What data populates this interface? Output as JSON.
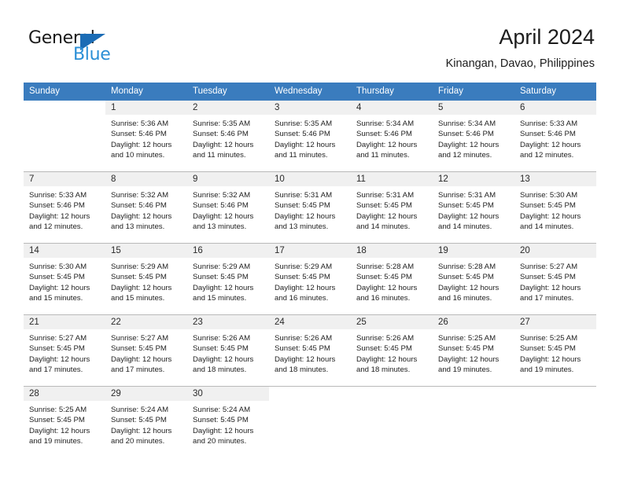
{
  "brand": {
    "name_top": "General",
    "name_bottom": "Blue",
    "color_dark": "#1a1a1a",
    "color_blue": "#2b8fd6",
    "triangle_color": "#1b6cb5"
  },
  "header": {
    "title": "April 2024",
    "subtitle": "Kinangan, Davao, Philippines"
  },
  "theme": {
    "header_row_bg": "#3a7cbe",
    "header_row_text": "#ffffff",
    "daynum_bg": "#f0f0f0",
    "grid_line": "#b9b9b9",
    "body_text": "#222222"
  },
  "weekdays": [
    "Sunday",
    "Monday",
    "Tuesday",
    "Wednesday",
    "Thursday",
    "Friday",
    "Saturday"
  ],
  "weeks": [
    [
      {
        "blank": true,
        "day": ""
      },
      {
        "blank": false,
        "day": "1",
        "sunrise": "Sunrise: 5:36 AM",
        "sunset": "Sunset: 5:46 PM",
        "daylight1": "Daylight: 12 hours",
        "daylight2": "and 10 minutes."
      },
      {
        "blank": false,
        "day": "2",
        "sunrise": "Sunrise: 5:35 AM",
        "sunset": "Sunset: 5:46 PM",
        "daylight1": "Daylight: 12 hours",
        "daylight2": "and 11 minutes."
      },
      {
        "blank": false,
        "day": "3",
        "sunrise": "Sunrise: 5:35 AM",
        "sunset": "Sunset: 5:46 PM",
        "daylight1": "Daylight: 12 hours",
        "daylight2": "and 11 minutes."
      },
      {
        "blank": false,
        "day": "4",
        "sunrise": "Sunrise: 5:34 AM",
        "sunset": "Sunset: 5:46 PM",
        "daylight1": "Daylight: 12 hours",
        "daylight2": "and 11 minutes."
      },
      {
        "blank": false,
        "day": "5",
        "sunrise": "Sunrise: 5:34 AM",
        "sunset": "Sunset: 5:46 PM",
        "daylight1": "Daylight: 12 hours",
        "daylight2": "and 12 minutes."
      },
      {
        "blank": false,
        "day": "6",
        "sunrise": "Sunrise: 5:33 AM",
        "sunset": "Sunset: 5:46 PM",
        "daylight1": "Daylight: 12 hours",
        "daylight2": "and 12 minutes."
      }
    ],
    [
      {
        "blank": false,
        "day": "7",
        "sunrise": "Sunrise: 5:33 AM",
        "sunset": "Sunset: 5:46 PM",
        "daylight1": "Daylight: 12 hours",
        "daylight2": "and 12 minutes."
      },
      {
        "blank": false,
        "day": "8",
        "sunrise": "Sunrise: 5:32 AM",
        "sunset": "Sunset: 5:46 PM",
        "daylight1": "Daylight: 12 hours",
        "daylight2": "and 13 minutes."
      },
      {
        "blank": false,
        "day": "9",
        "sunrise": "Sunrise: 5:32 AM",
        "sunset": "Sunset: 5:46 PM",
        "daylight1": "Daylight: 12 hours",
        "daylight2": "and 13 minutes."
      },
      {
        "blank": false,
        "day": "10",
        "sunrise": "Sunrise: 5:31 AM",
        "sunset": "Sunset: 5:45 PM",
        "daylight1": "Daylight: 12 hours",
        "daylight2": "and 13 minutes."
      },
      {
        "blank": false,
        "day": "11",
        "sunrise": "Sunrise: 5:31 AM",
        "sunset": "Sunset: 5:45 PM",
        "daylight1": "Daylight: 12 hours",
        "daylight2": "and 14 minutes."
      },
      {
        "blank": false,
        "day": "12",
        "sunrise": "Sunrise: 5:31 AM",
        "sunset": "Sunset: 5:45 PM",
        "daylight1": "Daylight: 12 hours",
        "daylight2": "and 14 minutes."
      },
      {
        "blank": false,
        "day": "13",
        "sunrise": "Sunrise: 5:30 AM",
        "sunset": "Sunset: 5:45 PM",
        "daylight1": "Daylight: 12 hours",
        "daylight2": "and 14 minutes."
      }
    ],
    [
      {
        "blank": false,
        "day": "14",
        "sunrise": "Sunrise: 5:30 AM",
        "sunset": "Sunset: 5:45 PM",
        "daylight1": "Daylight: 12 hours",
        "daylight2": "and 15 minutes."
      },
      {
        "blank": false,
        "day": "15",
        "sunrise": "Sunrise: 5:29 AM",
        "sunset": "Sunset: 5:45 PM",
        "daylight1": "Daylight: 12 hours",
        "daylight2": "and 15 minutes."
      },
      {
        "blank": false,
        "day": "16",
        "sunrise": "Sunrise: 5:29 AM",
        "sunset": "Sunset: 5:45 PM",
        "daylight1": "Daylight: 12 hours",
        "daylight2": "and 15 minutes."
      },
      {
        "blank": false,
        "day": "17",
        "sunrise": "Sunrise: 5:29 AM",
        "sunset": "Sunset: 5:45 PM",
        "daylight1": "Daylight: 12 hours",
        "daylight2": "and 16 minutes."
      },
      {
        "blank": false,
        "day": "18",
        "sunrise": "Sunrise: 5:28 AM",
        "sunset": "Sunset: 5:45 PM",
        "daylight1": "Daylight: 12 hours",
        "daylight2": "and 16 minutes."
      },
      {
        "blank": false,
        "day": "19",
        "sunrise": "Sunrise: 5:28 AM",
        "sunset": "Sunset: 5:45 PM",
        "daylight1": "Daylight: 12 hours",
        "daylight2": "and 16 minutes."
      },
      {
        "blank": false,
        "day": "20",
        "sunrise": "Sunrise: 5:27 AM",
        "sunset": "Sunset: 5:45 PM",
        "daylight1": "Daylight: 12 hours",
        "daylight2": "and 17 minutes."
      }
    ],
    [
      {
        "blank": false,
        "day": "21",
        "sunrise": "Sunrise: 5:27 AM",
        "sunset": "Sunset: 5:45 PM",
        "daylight1": "Daylight: 12 hours",
        "daylight2": "and 17 minutes."
      },
      {
        "blank": false,
        "day": "22",
        "sunrise": "Sunrise: 5:27 AM",
        "sunset": "Sunset: 5:45 PM",
        "daylight1": "Daylight: 12 hours",
        "daylight2": "and 17 minutes."
      },
      {
        "blank": false,
        "day": "23",
        "sunrise": "Sunrise: 5:26 AM",
        "sunset": "Sunset: 5:45 PM",
        "daylight1": "Daylight: 12 hours",
        "daylight2": "and 18 minutes."
      },
      {
        "blank": false,
        "day": "24",
        "sunrise": "Sunrise: 5:26 AM",
        "sunset": "Sunset: 5:45 PM",
        "daylight1": "Daylight: 12 hours",
        "daylight2": "and 18 minutes."
      },
      {
        "blank": false,
        "day": "25",
        "sunrise": "Sunrise: 5:26 AM",
        "sunset": "Sunset: 5:45 PM",
        "daylight1": "Daylight: 12 hours",
        "daylight2": "and 18 minutes."
      },
      {
        "blank": false,
        "day": "26",
        "sunrise": "Sunrise: 5:25 AM",
        "sunset": "Sunset: 5:45 PM",
        "daylight1": "Daylight: 12 hours",
        "daylight2": "and 19 minutes."
      },
      {
        "blank": false,
        "day": "27",
        "sunrise": "Sunrise: 5:25 AM",
        "sunset": "Sunset: 5:45 PM",
        "daylight1": "Daylight: 12 hours",
        "daylight2": "and 19 minutes."
      }
    ],
    [
      {
        "blank": false,
        "day": "28",
        "sunrise": "Sunrise: 5:25 AM",
        "sunset": "Sunset: 5:45 PM",
        "daylight1": "Daylight: 12 hours",
        "daylight2": "and 19 minutes."
      },
      {
        "blank": false,
        "day": "29",
        "sunrise": "Sunrise: 5:24 AM",
        "sunset": "Sunset: 5:45 PM",
        "daylight1": "Daylight: 12 hours",
        "daylight2": "and 20 minutes."
      },
      {
        "blank": false,
        "day": "30",
        "sunrise": "Sunrise: 5:24 AM",
        "sunset": "Sunset: 5:45 PM",
        "daylight1": "Daylight: 12 hours",
        "daylight2": "and 20 minutes."
      },
      {
        "blank": true,
        "day": ""
      },
      {
        "blank": true,
        "day": ""
      },
      {
        "blank": true,
        "day": ""
      },
      {
        "blank": true,
        "day": ""
      }
    ]
  ]
}
